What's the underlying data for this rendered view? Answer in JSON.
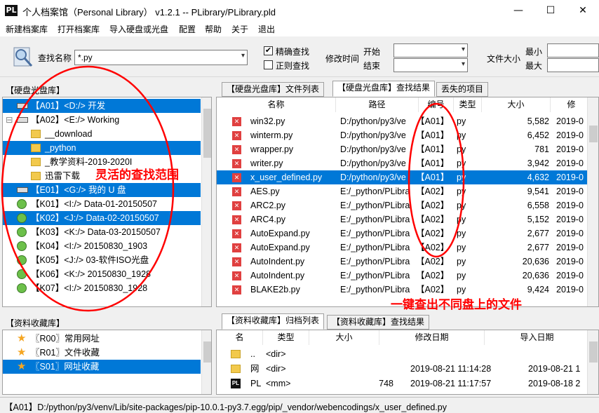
{
  "window": {
    "icon_text": "PL",
    "title": "个人档案馆（Personal Library） v1.2.1 -- PLibrary/PLibrary.pld",
    "minimize": "—",
    "maximize": "☐",
    "close": "✕"
  },
  "menu": [
    "新建档案库",
    "打开档案库",
    "导入硬盘或光盘",
    "配置",
    "帮助",
    "关于",
    "退出"
  ],
  "toolbar": {
    "search_label": "查找名称",
    "search_value": "*.py",
    "exact_label": "精确查找",
    "exact_checked": true,
    "regex_label": "正则查找",
    "regex_checked": false,
    "mtime_label": "修改时间",
    "start_label": "开始",
    "end_label": "结束",
    "size_label": "文件大小",
    "min_label": "最小",
    "max_label": "最大"
  },
  "disk_panel": {
    "title": "【硬盘光盘库】",
    "items": [
      {
        "text": "【A01】<D:/> 开发",
        "selected": true,
        "icon": "drive-icon",
        "indent": 0
      },
      {
        "text": "【A02】<E:/> Working",
        "selected": false,
        "icon": "drive-icon",
        "indent": 0
      },
      {
        "text": "__download",
        "selected": false,
        "icon": "folder-icon",
        "indent": 1
      },
      {
        "text": "_python",
        "selected": true,
        "icon": "folder-icon",
        "indent": 1
      },
      {
        "text": "_教学资料-2019-2020I",
        "selected": false,
        "icon": "folder-icon",
        "indent": 1
      },
      {
        "text": "迅雷下载",
        "selected": false,
        "icon": "folder-icon",
        "indent": 1
      },
      {
        "text": "【E01】<G:/> 我的 U 盘",
        "selected": true,
        "icon": "drive-icon",
        "indent": 0
      },
      {
        "text": "【K01】<I:/> Data-01-20150507",
        "selected": false,
        "icon": "disc-icon",
        "indent": 0
      },
      {
        "text": "【K02】<J:/> Data-02-20150507",
        "selected": true,
        "icon": "disc-icon",
        "indent": 0
      },
      {
        "text": "【K03】<K:/> Data-03-20150507",
        "selected": false,
        "icon": "disc-icon",
        "indent": 0
      },
      {
        "text": "【K04】<I:/> 20150830_1903",
        "selected": false,
        "icon": "disc-icon",
        "indent": 0
      },
      {
        "text": "【K05】<J:/> 03-软件ISO光盘",
        "selected": false,
        "icon": "disc-icon",
        "indent": 0
      },
      {
        "text": "【K06】<K:/> 20150830_1928",
        "selected": false,
        "icon": "disc-icon",
        "indent": 0
      },
      {
        "text": "【K07】<I:/> 20150830_1928",
        "selected": false,
        "icon": "disc-icon",
        "indent": 0
      }
    ]
  },
  "result_tabs": [
    "【硬盘光盘库】文件列表",
    "【硬盘光盘库】查找结果",
    "丢失的项目"
  ],
  "result_columns": [
    "名称",
    "路径",
    "编号",
    "类型",
    "大小",
    "修"
  ],
  "results": [
    {
      "name": "win32.py",
      "path": "D:/python/py3/ve",
      "id": "【A01】",
      "type": "py",
      "size": "5,582",
      "mod": "2019-0",
      "selected": false
    },
    {
      "name": "winterm.py",
      "path": "D:/python/py3/ve",
      "id": "【A01】",
      "type": "py",
      "size": "6,452",
      "mod": "2019-0",
      "selected": false
    },
    {
      "name": "wrapper.py",
      "path": "D:/python/py3/ve",
      "id": "【A01】",
      "type": "py",
      "size": "781",
      "mod": "2019-0",
      "selected": false
    },
    {
      "name": "writer.py",
      "path": "D:/python/py3/ve",
      "id": "【A01】",
      "type": "py",
      "size": "3,942",
      "mod": "2019-0",
      "selected": false
    },
    {
      "name": "x_user_defined.py",
      "path": "D:/python/py3/ve",
      "id": "【A01】",
      "type": "py",
      "size": "4,632",
      "mod": "2019-0",
      "selected": true
    },
    {
      "name": "AES.py",
      "path": "E:/_python/PLibra",
      "id": "【A02】",
      "type": "py",
      "size": "9,541",
      "mod": "2019-0",
      "selected": false
    },
    {
      "name": "ARC2.py",
      "path": "E:/_python/PLibra",
      "id": "【A02】",
      "type": "py",
      "size": "6,558",
      "mod": "2019-0",
      "selected": false
    },
    {
      "name": "ARC4.py",
      "path": "E:/_python/PLibra",
      "id": "【A02】",
      "type": "py",
      "size": "5,152",
      "mod": "2019-0",
      "selected": false
    },
    {
      "name": "AutoExpand.py",
      "path": "E:/_python/PLibra",
      "id": "【A02】",
      "type": "py",
      "size": "2,677",
      "mod": "2019-0",
      "selected": false
    },
    {
      "name": "AutoExpand.py",
      "path": "E:/_python/PLibra",
      "id": "【A02】",
      "type": "py",
      "size": "2,677",
      "mod": "2019-0",
      "selected": false
    },
    {
      "name": "AutoIndent.py",
      "path": "E:/_python/PLibra",
      "id": "【A02】",
      "type": "py",
      "size": "20,636",
      "mod": "2019-0",
      "selected": false
    },
    {
      "name": "AutoIndent.py",
      "path": "E:/_python/PLibra",
      "id": "【A02】",
      "type": "py",
      "size": "20,636",
      "mod": "2019-0",
      "selected": false
    },
    {
      "name": "BLAKE2b.py",
      "path": "E:/_python/PLibra",
      "id": "【A02】",
      "type": "py",
      "size": "9,424",
      "mod": "2019-0",
      "selected": false
    }
  ],
  "fav_panel": {
    "title": "【资料收藏库】",
    "items": [
      {
        "text": "〖R00〗常用网址",
        "selected": false
      },
      {
        "text": "〖R01〗文件收藏",
        "selected": false
      },
      {
        "text": "〖S01〗网址收藏",
        "selected": true
      }
    ]
  },
  "archive_tabs": [
    "【资料收藏库】归档列表",
    "【资料收藏库】查找结果"
  ],
  "archive_columns": [
    "名",
    "类型",
    "大小",
    "修改日期",
    "导入日期"
  ],
  "archive_rows": [
    {
      "name": "..",
      "type": "<dir>",
      "size": "",
      "mod": "",
      "imp": "",
      "icon": "folder-icon"
    },
    {
      "name": "网",
      "type": "<dir>",
      "size": "",
      "mod": "2019-08-21 11:14:28",
      "imp": "2019-08-21 1",
      "icon": "folder-icon"
    },
    {
      "name": "PL",
      "type": "<mm>",
      "size": "748",
      "mod": "2019-08-21 11:17:57",
      "imp": "2019-08-18 2",
      "icon": "pl-icon"
    }
  ],
  "status": "【A01】D:/python/py3/venv/Lib/site-packages/pip-10.0.1-py3.7.egg/pip/_vendor/webencodings/x_user_defined.py",
  "annotations": {
    "left": "灵活的查找范围",
    "right": "一键查出不同盘上的文件"
  }
}
